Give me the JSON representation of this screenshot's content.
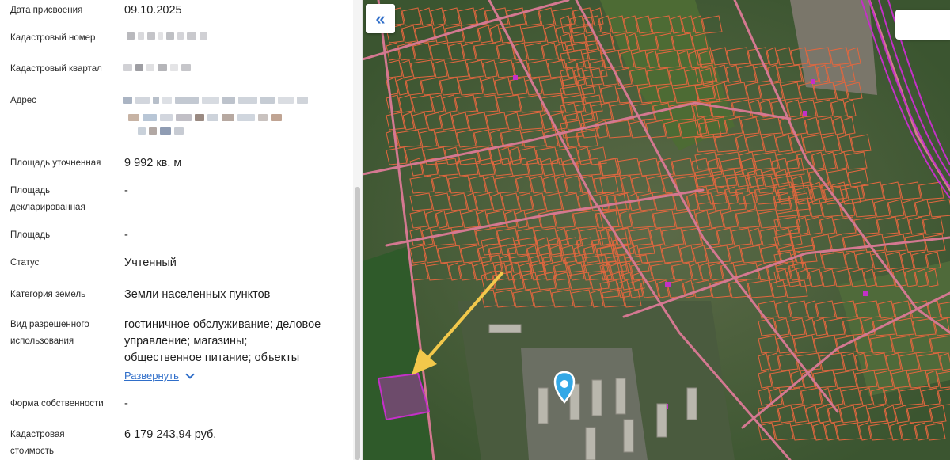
{
  "info": {
    "date_label": "Дата присвоения",
    "date_value": "09.10.2025",
    "cadastral_number_label": "Кадастровый номер",
    "cadastral_quarter_label": "Кадастровый квартал",
    "address_label": "Адрес",
    "area_refined_label": "Площадь уточненная",
    "area_refined_value": "9 992 кв. м",
    "area_declared_label_1": "Площадь",
    "area_declared_label_2": "декларированная",
    "area_declared_value": "-",
    "area_label": "Площадь",
    "area_value": "-",
    "status_label": "Статус",
    "status_value": "Учтенный",
    "land_category_label": "Категория земель",
    "land_category_value": "Земли населенных пунктов",
    "permitted_use_label_1": "Вид разрешенного",
    "permitted_use_label_2": "использования",
    "permitted_use_line_1": "гостиничное обслуживание; деловое",
    "permitted_use_line_2": "управление; магазины;",
    "permitted_use_line_3": "общественное питание; объекты",
    "expand_label": "Развернуть",
    "ownership_label": "Форма собственности",
    "ownership_value": "-",
    "cadastral_value_label_1": "Кадастровая",
    "cadastral_value_label_2": "стоимость",
    "cadastral_value_value": "6 179 243,94 руб."
  },
  "map": {
    "collapse_icon": "«",
    "colors": {
      "parcel_outline": "#e2673f",
      "highlight": "#c430c8",
      "road": "#d47891",
      "arrow": "#f2c84b",
      "pin": "#33a8e6"
    }
  }
}
